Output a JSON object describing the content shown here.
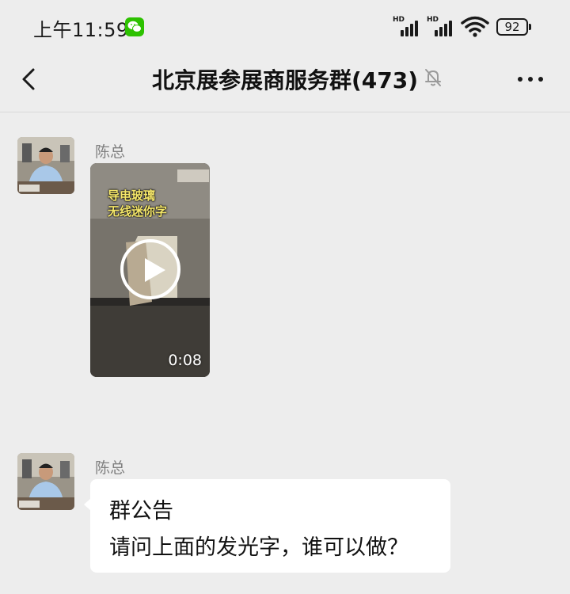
{
  "status_bar": {
    "time": "上午11:59",
    "signal_1_label": "HD",
    "signal_2_label": "HD",
    "battery_level": "92",
    "notification_icon": "wechat-icon"
  },
  "chat": {
    "title": "北京展参展商服务群(473)",
    "muted": true
  },
  "messages": [
    {
      "sender": "陈总",
      "type": "video",
      "video": {
        "caption_line1": "导电玻璃",
        "caption_line2": "无线迷你字",
        "duration": "0:08"
      }
    },
    {
      "sender": "陈总",
      "type": "text",
      "text_line1": "群公告",
      "text_line2": "请问上面的发光字，谁可以做？"
    }
  ],
  "colors": {
    "background": "#ededed",
    "bubble": "#ffffff",
    "wechat_green": "#2dc100",
    "sender_name": "#7f7f7f"
  }
}
